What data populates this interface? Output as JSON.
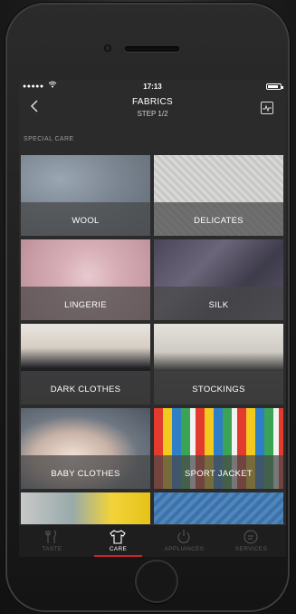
{
  "status": {
    "signal": "●●●●●",
    "time": "17:13"
  },
  "header": {
    "title": "FABRICS",
    "subtitle": "STEP 1/2"
  },
  "section_label": "SPECIAL CARE",
  "tiles": [
    {
      "label": "WOOL"
    },
    {
      "label": "DELICATES"
    },
    {
      "label": "LINGERIE"
    },
    {
      "label": "SILK"
    },
    {
      "label": "DARK CLOTHES"
    },
    {
      "label": "STOCKINGS"
    },
    {
      "label": "BABY CLOTHES"
    },
    {
      "label": "SPORT JACKET"
    }
  ],
  "tabs": [
    {
      "label": "TASTE",
      "icon": "fork-knife-icon"
    },
    {
      "label": "CARE",
      "icon": "shirt-icon",
      "active": true
    },
    {
      "label": "APPLIANCES",
      "icon": "power-icon"
    },
    {
      "label": "SERVICES",
      "icon": "chat-icon"
    }
  ],
  "colors": {
    "accent": "#d4202a",
    "background": "#2b2b2b",
    "tabbar": "#1e1e1e"
  }
}
